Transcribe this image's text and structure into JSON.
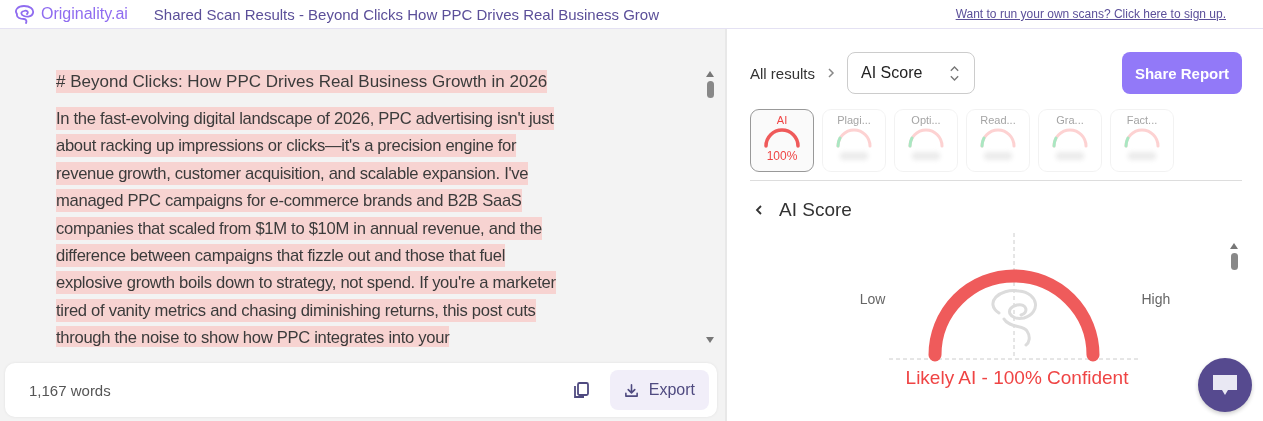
{
  "header": {
    "brand": "Originality.ai",
    "title": "Shared Scan Results - Beyond Clicks How PPC Drives Real Business Grow",
    "signup_link": "Want to run your own scans? Click here to sign up."
  },
  "document": {
    "heading": "# Beyond Clicks: How PPC Drives Real Business Growth in 2026",
    "paragraph": "In the fast-evolving digital landscape of 2026, PPC advertising isn't just about racking up impressions or clicks—it's a precision engine for revenue growth, customer acquisition, and scalable expansion. I've managed PPC campaigns for e-commerce brands and B2B SaaS companies that scaled from $1M to $10M in annual revenue, and the difference between campaigns that fizzle out and those that fuel explosive growth boils down to strategy, not spend. If you're a marketer tired of vanity metrics and chasing diminishing returns, this post cuts through the noise to show how PPC integrates into your"
  },
  "footer": {
    "word_count": "1,167 words",
    "export_button": "Export"
  },
  "results": {
    "breadcrumb": "All results",
    "selector": "AI Score",
    "share_button": "Share Report",
    "tiles": [
      {
        "label": "AI",
        "value": "100%",
        "selected": true,
        "level": 1
      },
      {
        "label": "Plagi...",
        "selected": false
      },
      {
        "label": "Opti...",
        "selected": false
      },
      {
        "label": "Read...",
        "selected": false
      },
      {
        "label": "Gra...",
        "selected": false
      },
      {
        "label": "Fact...",
        "selected": false
      }
    ],
    "section_title": "AI Score",
    "gauge": {
      "low_label": "Low",
      "high_label": "High",
      "verdict": "Likely AI - 100% Confident"
    }
  }
}
